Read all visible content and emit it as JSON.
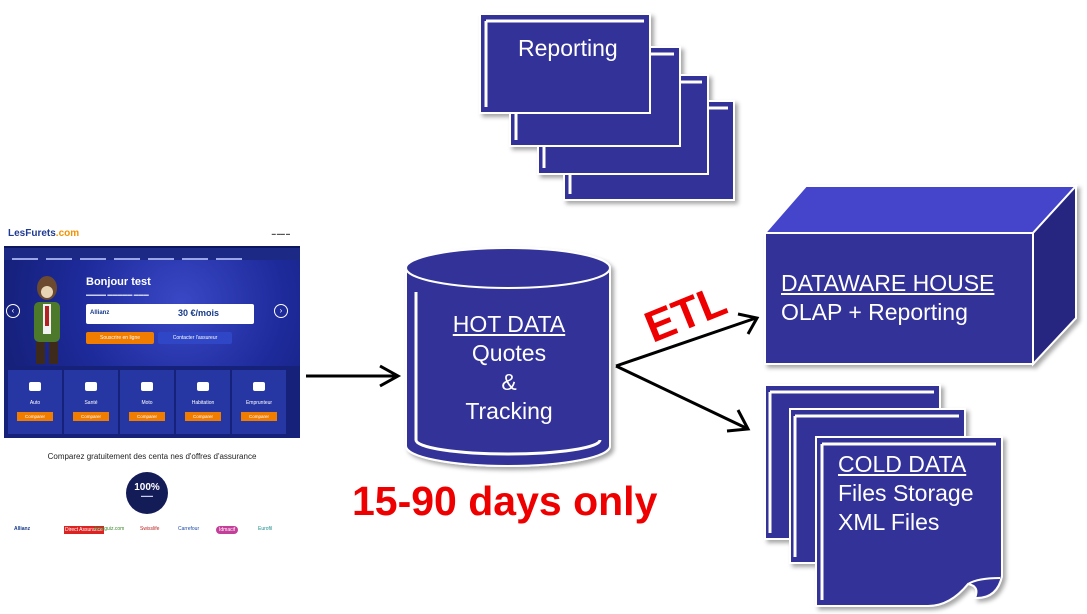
{
  "website": {
    "logo_main": "LesFurets",
    "logo_suffix": ".com",
    "greeting": "Bonjour test",
    "quote_brand": "Allianz",
    "quote_price": "30 €/mois",
    "cta_primary": "Souscrire en ligne",
    "cta_secondary": "Contacter l'assureur",
    "tiles": [
      {
        "label": "Auto",
        "button": "Comparer"
      },
      {
        "label": "Santé",
        "button": "Comparer"
      },
      {
        "label": "Moto",
        "button": "Comparer"
      },
      {
        "label": "Habitation",
        "button": "Comparer"
      },
      {
        "label": "Emprunteur",
        "button": "Comparer"
      }
    ],
    "tagline": "Comparez gratuitement des centa nes d'offres d'assurance",
    "badge": "100%",
    "partners": [
      "Allianz",
      "Direct Assurance",
      "Amaguiz.com",
      "Swisslife",
      "Carrefour",
      "Idmacif",
      "Eurofil"
    ]
  },
  "reporting": {
    "label": "Reporting"
  },
  "hot_data": {
    "title": "HOT DATA",
    "line1": "Quotes",
    "line2": "&",
    "line3": "Tracking",
    "retention": "15-90 days only"
  },
  "etl": {
    "label": "ETL"
  },
  "warehouse": {
    "title": "DATAWARE HOUSE",
    "line1": "OLAP + Reporting"
  },
  "cold_data": {
    "title": "COLD DATA",
    "line1": "Files Storage",
    "line2": "XML Files"
  },
  "colors": {
    "shape_fill": "#333399",
    "shape_stroke": "#ffffff",
    "arrow": "#000000",
    "accent_text": "#ee0000",
    "label_text": "#ffffff"
  }
}
